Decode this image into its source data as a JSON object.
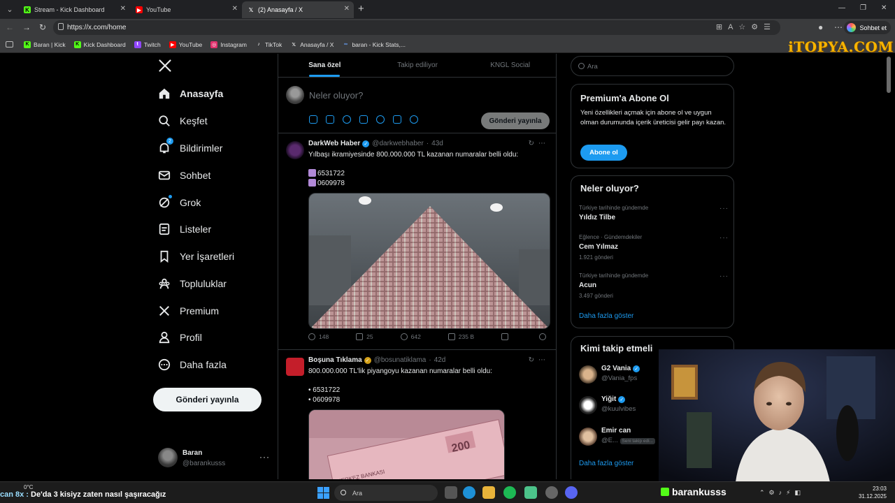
{
  "browser": {
    "tabs": [
      {
        "title": "Stream - Kick Dashboard",
        "favicon": "kick-icon",
        "color": "#53fc18"
      },
      {
        "title": "YouTube",
        "favicon": "youtube-icon",
        "color": "#ff0000"
      },
      {
        "title": "(2) Anasayfa / X",
        "favicon": "x-icon",
        "color": "#ffffff",
        "active": true
      }
    ],
    "url": "https://x.com/home",
    "chat_button": "Sohbet et",
    "bookmarks": [
      {
        "label": "Baran | Kick",
        "favicon": "kick-icon",
        "color": "#53fc18"
      },
      {
        "label": "Kick Dashboard",
        "favicon": "kick-icon",
        "color": "#53fc18"
      },
      {
        "label": "Twitch",
        "favicon": "twitch-icon",
        "color": "#9146ff"
      },
      {
        "label": "YouTube",
        "favicon": "youtube-icon",
        "color": "#ff0000"
      },
      {
        "label": "Instagram",
        "favicon": "instagram-icon",
        "color": "#e1306c"
      },
      {
        "label": "TikTok",
        "favicon": "tiktok-icon",
        "color": "#ffffff"
      },
      {
        "label": "Anasayfa / X",
        "favicon": "x-icon",
        "color": "#ffffff"
      },
      {
        "label": "baran - Kick Stats,...",
        "favicon": "stats-icon",
        "color": "#6aa6ff"
      }
    ],
    "watermark": "iTOPYA.COM"
  },
  "nav": {
    "items": [
      {
        "label": "Anasayfa",
        "icon": "home-icon",
        "active": true
      },
      {
        "label": "Keşfet",
        "icon": "search-icon"
      },
      {
        "label": "Bildirimler",
        "icon": "bell-icon",
        "badge": "2"
      },
      {
        "label": "Sohbet",
        "icon": "mail-icon"
      },
      {
        "label": "Grok",
        "icon": "grok-icon",
        "dot": true
      },
      {
        "label": "Listeler",
        "icon": "list-icon"
      },
      {
        "label": "Yer İşaretleri",
        "icon": "bookmark-icon"
      },
      {
        "label": "Topluluklar",
        "icon": "communities-icon"
      },
      {
        "label": "Premium",
        "icon": "x-icon"
      },
      {
        "label": "Profil",
        "icon": "person-icon"
      },
      {
        "label": "Daha fazla",
        "icon": "more-circle-icon"
      }
    ],
    "post_button": "Gönderi yayınla",
    "account": {
      "name": "Baran",
      "handle": "@barankusss"
    }
  },
  "feed": {
    "tabs": [
      "Sana özel",
      "Takip ediliyor",
      "KNGL Social"
    ],
    "composer": {
      "placeholder": "Neler oluyor?",
      "post_button": "Gönderi yayınla"
    },
    "posts": [
      {
        "name": "DarkWeb Haber",
        "verified": "blue",
        "handle": "@darkwebhaber",
        "time": "43d",
        "text": "Yılbaşı ikramiyesinde 800.000.000 TL kazanan numaralar belli oldu:",
        "numbers": [
          "6531722",
          "0609978"
        ],
        "stats": {
          "replies": "148",
          "reposts": "25",
          "likes": "642",
          "views": "235 B"
        }
      },
      {
        "name": "Boşuna Tıklama",
        "verified": "gold",
        "handle": "@bosunatiklama",
        "time": "42d",
        "text": "800.000.000 TL'lik piyangoyu kazanan numaralar belli oldu:",
        "numbers": [
          "• 6531722",
          "• 0609978"
        ],
        "image_caption": "MERKEZ BANKASI"
      }
    ]
  },
  "sidebar": {
    "search_placeholder": "Ara",
    "premium": {
      "title": "Premium'a Abone Ol",
      "desc": "Yeni özellikleri açmak için abone ol ve uygun olman durumunda içerik üreticisi gelir payı kazan.",
      "button": "Abone ol"
    },
    "trends": {
      "title": "Neler oluyor?",
      "items": [
        {
          "context": "Türkiye tarihinde gündemde",
          "topic": "Yıldız Tilbe",
          "count": ""
        },
        {
          "context": "Eğlence · Gündemdekiler",
          "topic": "Cem Yılmaz",
          "count": "1.921 gönderi"
        },
        {
          "context": "Türkiye tarihinde gündemde",
          "topic": "Acun",
          "count": "3.497 gönderi"
        }
      ],
      "show_more": "Daha fazla göster"
    },
    "who_to_follow": {
      "title": "Kimi takip etmeli",
      "items": [
        {
          "name": "G2 Vania",
          "handle": "@Vania_fps"
        },
        {
          "name": "Yiğit",
          "handle": "@kuulvibes"
        },
        {
          "name": "Emir can",
          "handle": "@E...",
          "note": "Seni takip edi..."
        }
      ],
      "show_more": "Daha fazla göster"
    }
  },
  "taskbar": {
    "weather": "0°C",
    "ticker_prefix": "can 8x :",
    "ticker": "De'da 3 kisiyz zaten nasıl şaşıracağız",
    "search": "Ara",
    "streamer": "barankusss",
    "time": "23:03",
    "date": "31.12.2025"
  }
}
